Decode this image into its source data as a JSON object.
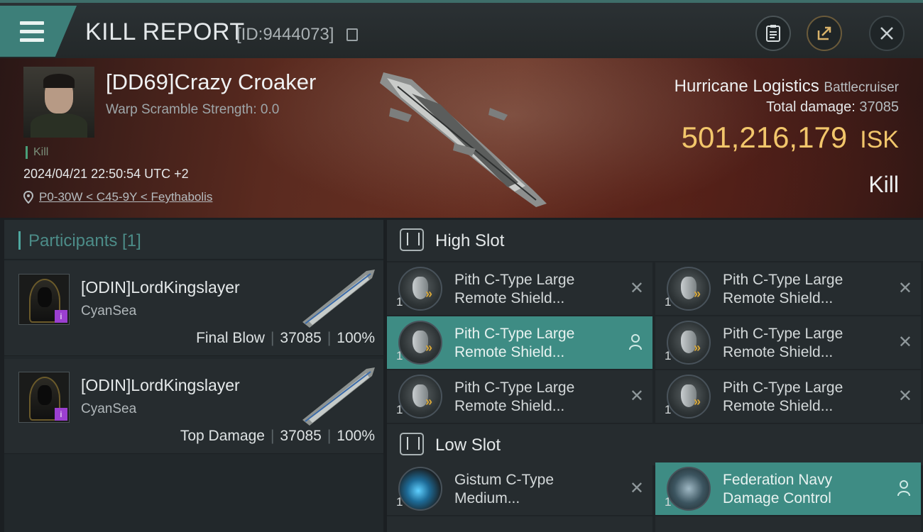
{
  "header": {
    "title": "KILL REPORT",
    "report_id": "[ID:9444073]"
  },
  "victim": {
    "name": "[DD69]Crazy Croaker",
    "warp_scramble": "Warp Scramble Strength: 0.0",
    "tag": "Kill",
    "timestamp": "2024/04/21 22:50:54 UTC +2",
    "location": "P0-30W < C45-9Y < Feythabolis",
    "ship_name": "Hurricane Logistics",
    "ship_class": "Battlecruiser",
    "total_damage_label": "Total damage:",
    "total_damage_value": "37085",
    "isk_value": "501,216,179",
    "isk_unit": "ISK",
    "result": "Kill"
  },
  "participants": {
    "header": "Participants [1]",
    "items": [
      {
        "name": "[ODIN]LordKingslayer",
        "corp": "CyanSea",
        "role": "Final Blow",
        "damage": "37085",
        "percent": "100%"
      },
      {
        "name": "[ODIN]LordKingslayer",
        "corp": "CyanSea",
        "role": "Top Damage",
        "damage": "37085",
        "percent": "100%"
      }
    ]
  },
  "slots": {
    "high_label": "High Slot",
    "low_label": "Low Slot",
    "high": [
      {
        "line1": "Pith C-Type Large",
        "line2": "Remote Shield...",
        "qty": "1"
      },
      {
        "line1": "Pith C-Type Large",
        "line2": "Remote Shield...",
        "qty": "1"
      },
      {
        "line1": "Pith C-Type Large",
        "line2": "Remote Shield...",
        "qty": "1"
      },
      {
        "line1": "Pith C-Type Large",
        "line2": "Remote Shield...",
        "qty": "1"
      },
      {
        "line1": "Pith C-Type Large",
        "line2": "Remote Shield...",
        "qty": "1"
      },
      {
        "line1": "Pith C-Type Large",
        "line2": "Remote Shield...",
        "qty": "1"
      }
    ],
    "low": [
      {
        "line1": "Gistum C-Type",
        "line2": "Medium...",
        "qty": "1"
      },
      {
        "line1": "Federation Navy",
        "line2": "Damage Control",
        "qty": "1"
      }
    ]
  },
  "colors": {
    "accent": "#3e8c84",
    "isk": "#f2c66b",
    "implant_badge": "#9b3fd0"
  }
}
